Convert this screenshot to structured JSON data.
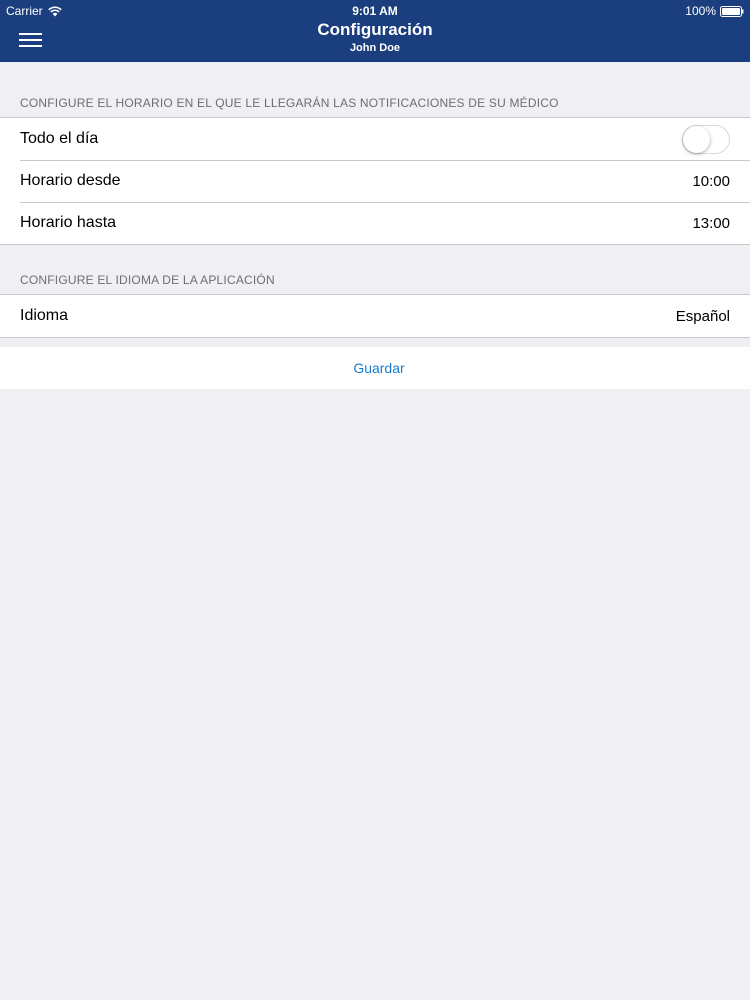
{
  "status_bar": {
    "carrier": "Carrier",
    "time": "9:01 AM",
    "battery": "100%"
  },
  "nav": {
    "title": "Configuración",
    "subtitle": "John Doe",
    "menu_icon": "hamburger-menu-icon",
    "background_color": "#1b3e7e"
  },
  "schedule_section": {
    "header": "CONFIGURE EL HORARIO EN EL QUE LE LLEGARÁN LAS NOTIFICACIONES DE SU MÉDICO",
    "all_day": {
      "label": "Todo el día",
      "enabled": false
    },
    "from": {
      "label": "Horario desde",
      "value": "10:00"
    },
    "to": {
      "label": "Horario hasta",
      "value": "13:00"
    }
  },
  "language_section": {
    "header": "CONFIGURE EL IDIOMA DE LA APLICACIÓN",
    "language": {
      "label": "Idioma",
      "value": "Español"
    }
  },
  "save": {
    "label": "Guardar",
    "color": "#1a7bd3"
  }
}
